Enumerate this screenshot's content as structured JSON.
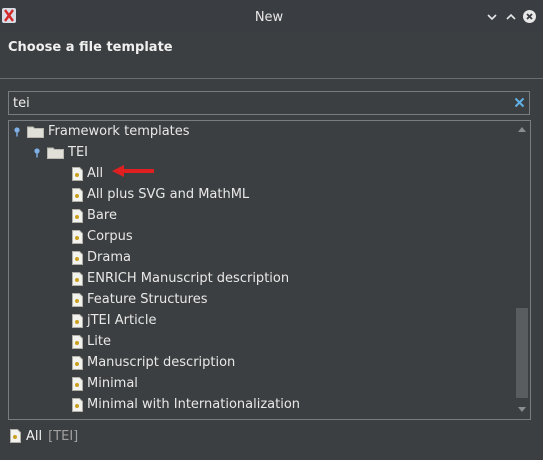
{
  "window": {
    "title": "New",
    "icons": [
      "app-icon",
      "minimize-icon",
      "maximize-icon",
      "close-icon"
    ]
  },
  "header": {
    "title": "Choose a file template"
  },
  "search": {
    "value": "tei",
    "placeholder": ""
  },
  "tree": {
    "root": {
      "label": "Framework templates",
      "expanded": true
    },
    "group": {
      "label": "TEI",
      "expanded": true
    },
    "items": [
      {
        "label": "All",
        "selected": true
      },
      {
        "label": "All plus SVG and MathML"
      },
      {
        "label": "Bare"
      },
      {
        "label": "Corpus"
      },
      {
        "label": "Drama"
      },
      {
        "label": "ENRICH Manuscript description"
      },
      {
        "label": "Feature Structures"
      },
      {
        "label": "jTEI Article"
      },
      {
        "label": "Lite"
      },
      {
        "label": "Manuscript description"
      },
      {
        "label": "Minimal"
      },
      {
        "label": "Minimal with Internationalization"
      }
    ]
  },
  "status": {
    "name": "All",
    "tag": "[TEI]"
  },
  "colors": {
    "background": "#3c3f41",
    "selection": "#4b6eaf",
    "annotation_arrow": "#e02020"
  }
}
